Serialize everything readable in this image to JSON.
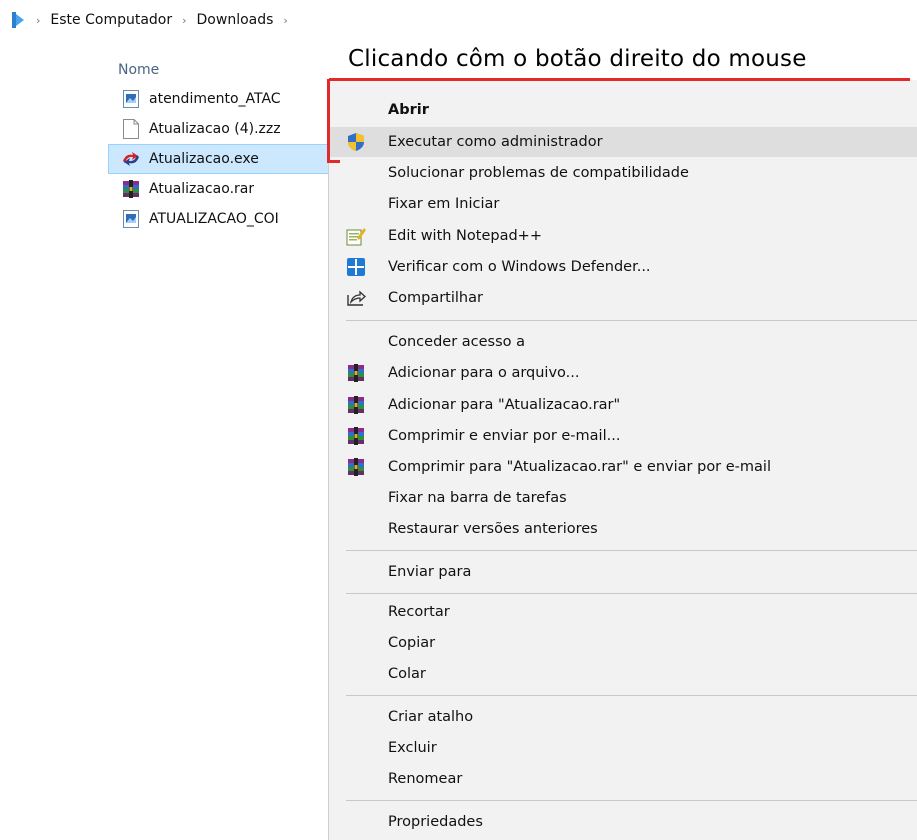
{
  "breadcrumb": {
    "items": [
      "Este Computador",
      "Downloads"
    ]
  },
  "file_list": {
    "column_header": "Nome",
    "files": [
      {
        "name": "atendimento_ATAC",
        "icon": "image-file-icon"
      },
      {
        "name": "Atualizacao (4).zzz",
        "icon": "blank-file-icon"
      },
      {
        "name": "Atualizacao.exe",
        "icon": "exe-app-icon",
        "selected": true
      },
      {
        "name": "Atualizacao.rar",
        "icon": "winrar-icon"
      },
      {
        "name": "ATUALIZACAO_COI",
        "icon": "image-file-icon"
      }
    ]
  },
  "annotation": {
    "text": "Clicando côm o botão direito do mouse",
    "color": "#e32a2a"
  },
  "context_menu": {
    "items": [
      {
        "label": "Abrir",
        "bold": true
      },
      {
        "label": "Executar como administrador",
        "icon": "uac-shield-icon",
        "highlighted": true
      },
      {
        "label": "Solucionar problemas de compatibilidade"
      },
      {
        "label": "Fixar em Iniciar"
      },
      {
        "label": "Edit with Notepad++",
        "icon": "notepad-plus-plus-icon"
      },
      {
        "label": "Verificar com o Windows Defender...",
        "icon": "windows-defender-icon"
      },
      {
        "label": "Compartilhar",
        "icon": "share-icon"
      },
      {
        "label": "Conceder acesso a"
      },
      {
        "label": "Adicionar para o arquivo...",
        "icon": "winrar-icon"
      },
      {
        "label": "Adicionar para \"Atualizacao.rar\"",
        "icon": "winrar-icon"
      },
      {
        "label": "Comprimir e enviar por e-mail...",
        "icon": "winrar-icon"
      },
      {
        "label": "Comprimir para \"Atualizacao.rar\" e enviar por e-mail",
        "icon": "winrar-icon"
      },
      {
        "label": "Fixar na barra de tarefas"
      },
      {
        "label": "Restaurar versões anteriores"
      },
      {
        "label": "Enviar para"
      },
      {
        "label": "Recortar"
      },
      {
        "label": "Copiar"
      },
      {
        "label": "Colar"
      },
      {
        "label": "Criar atalho"
      },
      {
        "label": "Excluir"
      },
      {
        "label": "Renomear"
      },
      {
        "label": "Propriedades"
      }
    ]
  }
}
